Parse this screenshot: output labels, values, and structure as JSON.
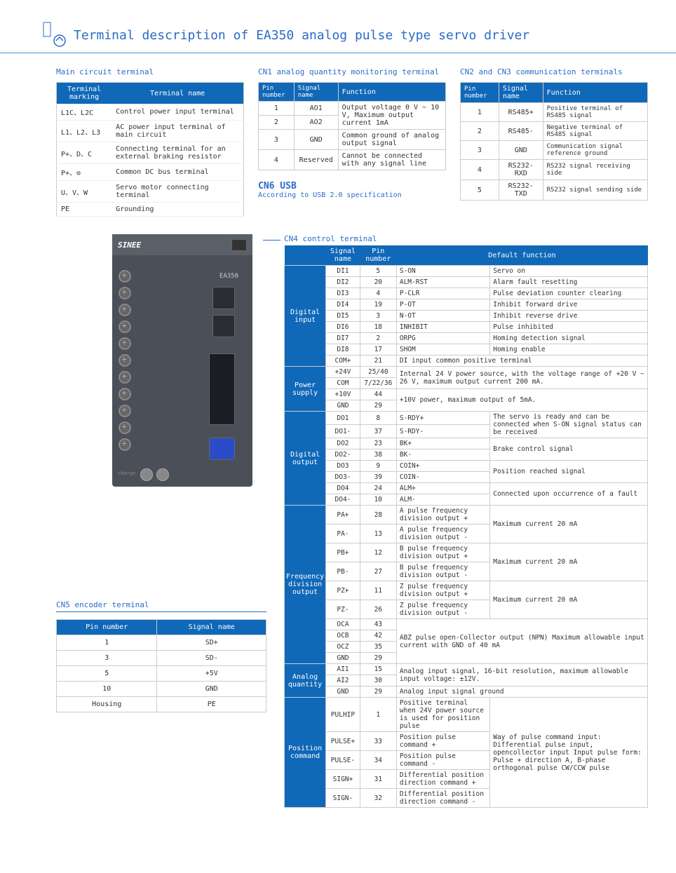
{
  "header": {
    "title": "Terminal description of EA350 analog pulse type servo driver"
  },
  "main_circuit": {
    "title": "Main circuit terminal",
    "headers": [
      "Terminal marking",
      "Terminal name"
    ],
    "rows": [
      [
        "L1C、L2C",
        "Control power input terminal"
      ],
      [
        "L1、L2、L3",
        "AC power input terminal of main circuit"
      ],
      [
        "P+、D、C",
        "Connecting terminal for an external braking resistor"
      ],
      [
        "P+、⊖",
        "Common DC bus terminal"
      ],
      [
        "U、V、W",
        "Servo motor connecting terminal"
      ],
      [
        "PE",
        "Grounding"
      ]
    ]
  },
  "cn1": {
    "title": "CN1 analog quantity monitoring terminal",
    "headers": [
      "Pin number",
      "Signal name",
      "Function"
    ],
    "rows": [
      {
        "pin": "1",
        "sig": "AO1",
        "func": "Output voltage 0 V ~ 10 V, Maximum output current 1mA",
        "rowspan": 2
      },
      {
        "pin": "2",
        "sig": "AO2"
      },
      {
        "pin": "3",
        "sig": "GND",
        "func": "Common ground of analog output signal"
      },
      {
        "pin": "4",
        "sig": "Reserved",
        "func": "Cannot be connected with any signal line"
      }
    ]
  },
  "cn2": {
    "title": "CN2 and CN3 communication terminals",
    "headers": [
      "Pin number",
      "Signal name",
      "Function"
    ],
    "rows": [
      [
        "1",
        "RS485+",
        "Positive terminal of RS485 signal"
      ],
      [
        "2",
        "RS485-",
        "Negative terminal of RS485  signal"
      ],
      [
        "3",
        "GND",
        "Communication signal reference ground"
      ],
      [
        "4",
        "RS232-RXD",
        "RS232 signal receiving side"
      ],
      [
        "5",
        "RS232-TXD",
        "RS232 signal sending side"
      ]
    ]
  },
  "cn6": {
    "title": "CN6 USB",
    "sub": "According to USB 2.0 specification"
  },
  "cn4": {
    "title": "CN4 control terminal",
    "headers": [
      "",
      "Signal name",
      "Pin number",
      "Default function",
      ""
    ],
    "digital_input": {
      "label": "Digital input",
      "rows": [
        [
          "DI1",
          "5",
          "S-ON",
          "Servo on"
        ],
        [
          "DI2",
          "20",
          "ALM-RST",
          "Alarm fault resetting"
        ],
        [
          "DI3",
          "4",
          "P-CLR",
          "Pulse deviation counter clearing"
        ],
        [
          "DI4",
          "19",
          "P-OT",
          "Inhibit forward drive"
        ],
        [
          "DI5",
          "3",
          "N-OT",
          "Inhibit reverse drive"
        ],
        [
          "DI6",
          "18",
          "INHIBIT",
          "Pulse inhibited"
        ],
        [
          "DI7",
          "2",
          "ORPG",
          "Homing detection signal"
        ],
        [
          "DI8",
          "17",
          "SHOM",
          "Homing enable"
        ],
        [
          "COM+",
          "21",
          "DI input common positive terminal",
          ""
        ]
      ]
    },
    "power": {
      "label": "Power supply",
      "rows": [
        [
          "+24V",
          "25/40",
          "Internal 24 V power source, with the voltage range of +20 V ~ 26 V, maximum output current 200 mA."
        ],
        [
          "COM",
          "7/22/36"
        ],
        [
          "+10V",
          "44",
          "+10V power, maximum output of 5mA."
        ],
        [
          "GND",
          "29"
        ]
      ]
    },
    "digital_output": {
      "label": "Digital output",
      "rows": [
        [
          "DO1",
          "8",
          "S-RDY+",
          "The servo is ready and can be connected when S-ON signal status can be received"
        ],
        [
          "DO1-",
          "37",
          "S-RDY-"
        ],
        [
          "DO2",
          "23",
          "BK+",
          "Brake control signal"
        ],
        [
          "DO2-",
          "38",
          "BK-"
        ],
        [
          "DO3",
          "9",
          "COIN+",
          "Position reached signal"
        ],
        [
          "DO3-",
          "39",
          "COIN-"
        ],
        [
          "DO4",
          "24",
          "ALM+",
          "Connected upon occurrence of a fault"
        ],
        [
          "DO4-",
          "10",
          "ALM-"
        ]
      ]
    },
    "freq": {
      "label": "Frequency division output",
      "rows": [
        [
          "PA+",
          "28",
          "A pulse frequency division output +",
          "Maximum current 20 mA"
        ],
        [
          "PA-",
          "13",
          "A pulse frequency division output -"
        ],
        [
          "PB+",
          "12",
          "B pulse frequency division output +",
          "Maximum current 20 mA"
        ],
        [
          "PB-",
          "27",
          "B pulse frequency division output -"
        ],
        [
          "PZ+",
          "11",
          "Z pulse frequency division output +",
          "Maximum current 20 mA"
        ],
        [
          "PZ-",
          "26",
          "Z pulse frequency division output -"
        ],
        [
          "OCA",
          "43",
          "ABZ pulse open-Collector output (NPN)\nMaximum allowable input current with GND of 40 mA"
        ],
        [
          "OCB",
          "42"
        ],
        [
          "OCZ",
          "35"
        ],
        [
          "GND",
          "29"
        ]
      ]
    },
    "analog": {
      "label": "Analog quantity",
      "rows": [
        [
          "AI1",
          "15",
          "Analog input signal, 16-bit resolution, maximum allowable input voltage: ±12V."
        ],
        [
          "AI2",
          "30"
        ],
        [
          "GND",
          "29",
          "Analog input signal ground"
        ]
      ]
    },
    "position": {
      "label": "Position command",
      "note": "Way of pulse command input: Differential pulse input, opencollector input\nInput pulse form: Pulse + direction A, B-phase orthogonal pulse CW/CCW pulse",
      "rows": [
        [
          "PULHIP",
          "1",
          "Positive terminal when 24V power source is used for position pulse"
        ],
        [
          "PULSE+",
          "33",
          "Position pulse command +"
        ],
        [
          "PULSE-",
          "34",
          "Position pulse command -"
        ],
        [
          "SIGN+",
          "31",
          "Differential position direction command +"
        ],
        [
          "SIGN-",
          "32",
          "Differential position direction command -"
        ]
      ]
    }
  },
  "cn5": {
    "title": "CN5 encoder terminal",
    "headers": [
      "Pin number",
      "Signal name"
    ],
    "rows": [
      [
        "1",
        "SD+"
      ],
      [
        "3",
        "SD-"
      ],
      [
        "5",
        "+5V"
      ],
      [
        "10",
        "GND"
      ],
      [
        "Housing",
        "PE"
      ]
    ]
  },
  "device": {
    "brand": "SINEE",
    "model": "EA350",
    "charge": "charge"
  }
}
